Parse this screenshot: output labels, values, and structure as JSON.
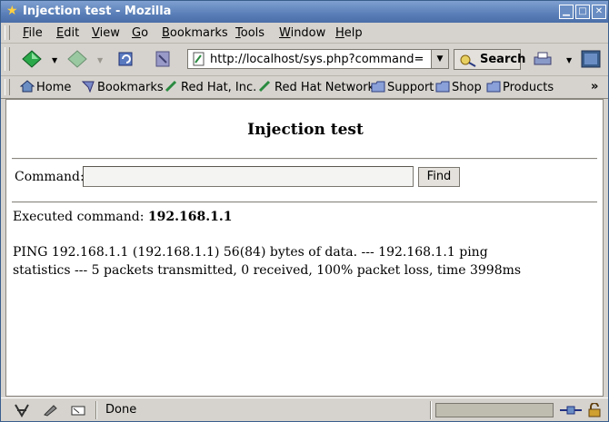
{
  "window": {
    "title": "Injection test - Mozilla"
  },
  "menu": [
    "File",
    "Edit",
    "View",
    "Go",
    "Bookmarks",
    "Tools",
    "Window",
    "Help"
  ],
  "menu_access_keys": [
    "F",
    "E",
    "V",
    "G",
    "B",
    "T",
    "W",
    "H"
  ],
  "navigation": {
    "url": "http://localhost/sys.php?command=",
    "search_label": "Search"
  },
  "bookmarks": [
    "Home",
    "Bookmarks",
    "Red Hat, Inc.",
    "Red Hat Network",
    "Support",
    "Shop",
    "Products"
  ],
  "bookmarks_more": "»",
  "page": {
    "heading": "Injection test",
    "command_label": "Command:",
    "command_value": "",
    "find_label": "Find",
    "executed_label": "Executed command:",
    "executed_value": "192.168.1.1",
    "output_text": "PING 192.168.1.1 (192.168.1.1) 56(84) bytes of data. --- 192.168.1.1 ping statistics --- 5 packets transmitted, 0 received, 100% packet loss, time 3998ms"
  },
  "status": {
    "text": "Done"
  },
  "colors": {
    "titlebar": "#5a7fb8",
    "chrome": "#d6d3ce",
    "content_bg": "#ffffff"
  }
}
